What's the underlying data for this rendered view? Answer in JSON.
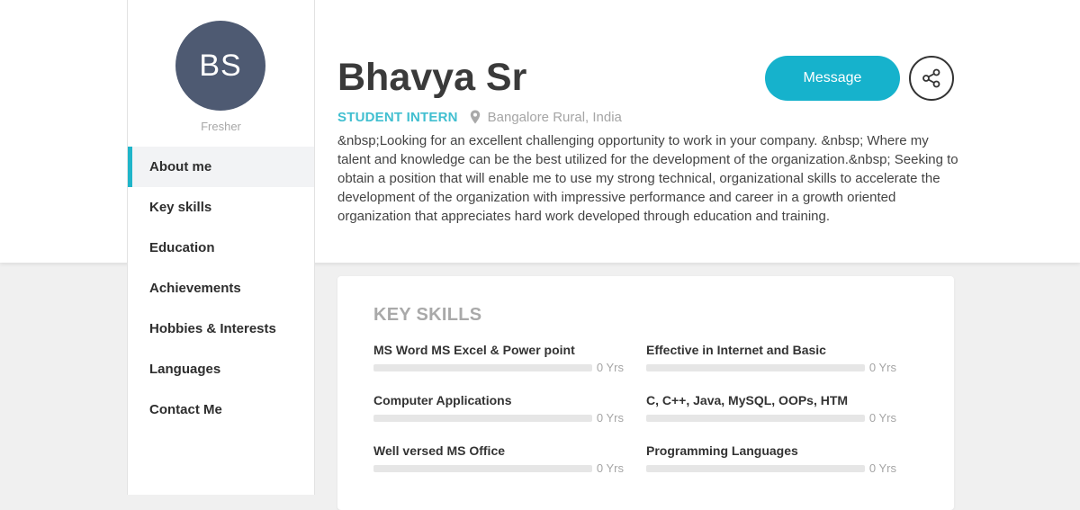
{
  "profile": {
    "initials": "BS",
    "level": "Fresher",
    "name": "Bhavya Sr",
    "role": "STUDENT INTERN",
    "location": "Bangalore Rural, India",
    "about": "&nbsp;Looking for an excellent challenging opportunity to work in your company. &nbsp; Where my talent and knowledge can be the best utilized for the development of the organization.&nbsp; Seeking to obtain a position that will enable me to use my strong technical, organizational skills to accelerate the development of the organization with impressive performance and career in a growth oriented organization that appreciates hard work developed through education and training.",
    "avatar_color": "#4e5a72"
  },
  "actions": {
    "message_label": "Message",
    "share_icon": "share-icon",
    "accent_color": "#16b2cc"
  },
  "sidebar": {
    "items": [
      {
        "label": "About me",
        "active": true
      },
      {
        "label": "Key skills",
        "active": false
      },
      {
        "label": "Education",
        "active": false
      },
      {
        "label": "Achievements",
        "active": false
      },
      {
        "label": "Hobbies & Interests",
        "active": false
      },
      {
        "label": "Languages",
        "active": false
      },
      {
        "label": "Contact Me",
        "active": false
      }
    ]
  },
  "skills": {
    "title": "KEY SKILLS",
    "items": [
      {
        "name": "MS Word MS Excel & Power point",
        "years": "0 Yrs",
        "level": 0
      },
      {
        "name": "Effective in Internet and Basic",
        "years": "0 Yrs",
        "level": 0
      },
      {
        "name": "Computer Applications",
        "years": "0 Yrs",
        "level": 0
      },
      {
        "name": "C, C++, Java, MySQL, OOPs, HTM",
        "years": "0 Yrs",
        "level": 0
      },
      {
        "name": "Well versed MS Office",
        "years": "0 Yrs",
        "level": 0
      },
      {
        "name": "Programming Languages",
        "years": "0 Yrs",
        "level": 0
      }
    ]
  }
}
